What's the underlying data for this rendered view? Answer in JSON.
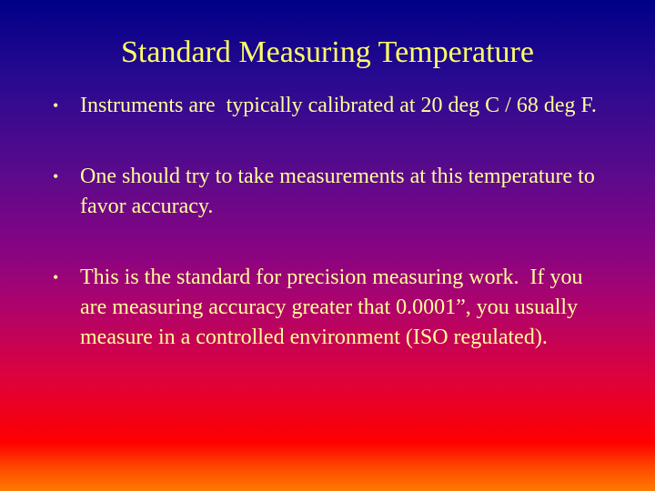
{
  "slide": {
    "title": "Standard Measuring Temperature",
    "bullet_glyph": "•",
    "bullets": [
      {
        "text": "Instruments are  typically calibrated at 20 deg C / 68 deg F."
      },
      {
        "text": "One should try to take measurements at this temperature to favor accuracy."
      },
      {
        "text": "This is the standard for precision measuring work.  If you are measuring accuracy greater that 0.0001”, you usually measure in a controlled environment (ISO regulated)."
      }
    ],
    "colors": {
      "text": "#ffff99",
      "title": "#ffff66",
      "gradient_top": "#000088",
      "gradient_middle": "#8a0482",
      "gradient_red": "#ff0000",
      "gradient_bottom": "#ff7a00"
    }
  }
}
